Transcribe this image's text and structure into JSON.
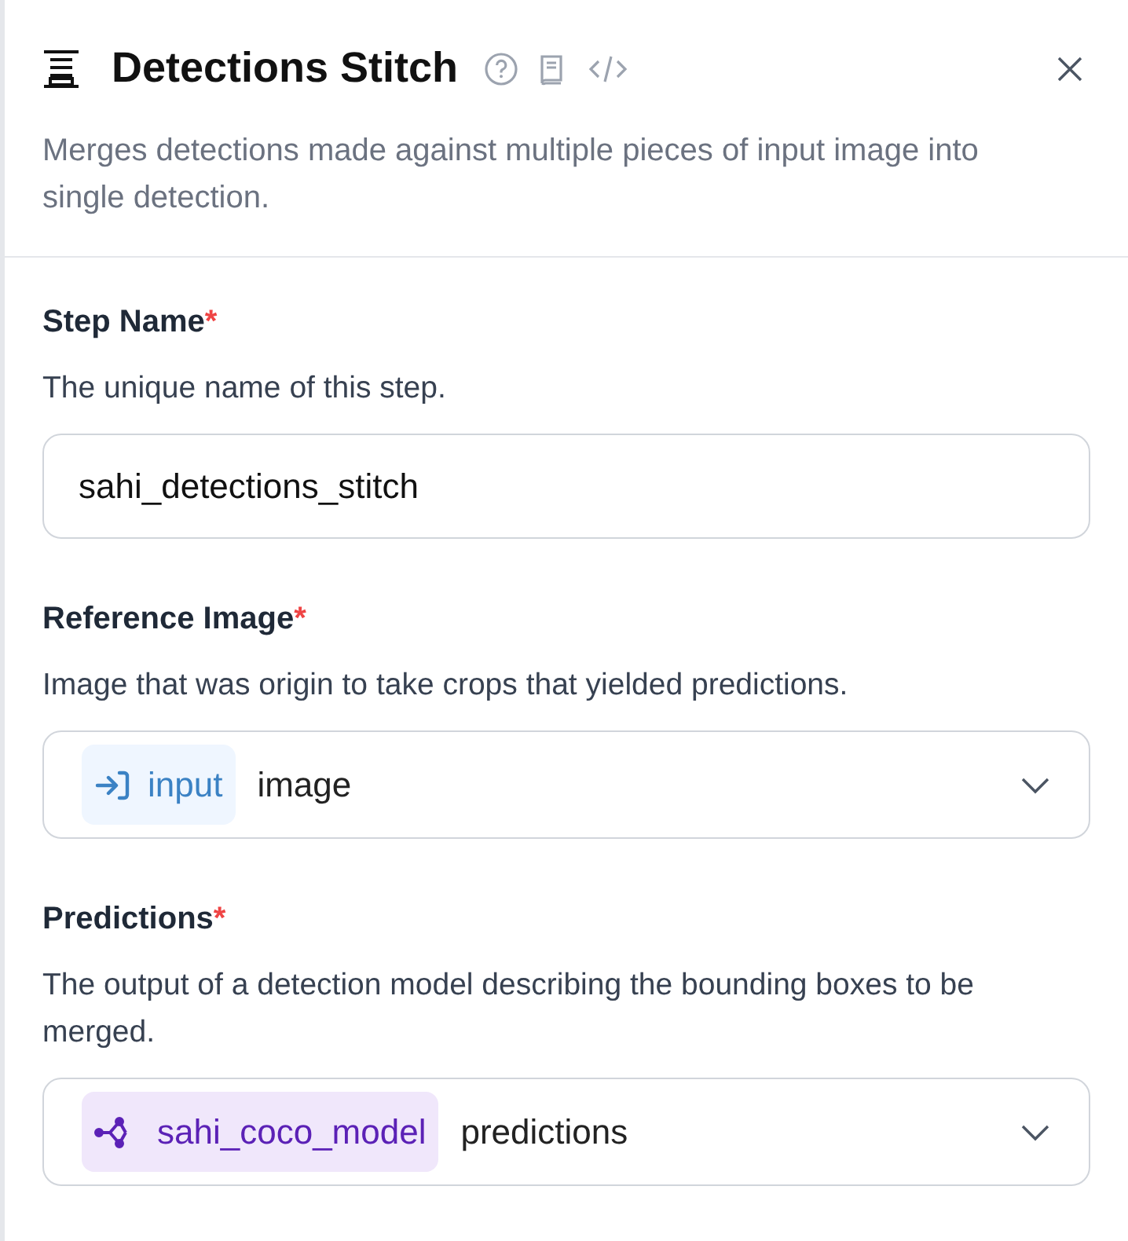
{
  "header": {
    "title": "Detections Stitch",
    "description": "Merges detections made against multiple pieces of input image into single detection."
  },
  "fields": [
    {
      "kind": "text",
      "label": "Step Name",
      "required_mark": "*",
      "help": "The unique name of this step.",
      "value": "sahi_detections_stitch"
    },
    {
      "kind": "select",
      "label": "Reference Image",
      "required_mark": "*",
      "help": "Image that was origin to take crops that yielded predictions.",
      "source": {
        "kind": "input",
        "name": "input"
      },
      "property": "image"
    },
    {
      "kind": "select",
      "label": "Predictions",
      "required_mark": "*",
      "help": "The output of a detection model describing the bounding boxes to be merged.",
      "source": {
        "kind": "step",
        "name": "sahi_coco_model"
      },
      "property": "predictions"
    }
  ]
}
